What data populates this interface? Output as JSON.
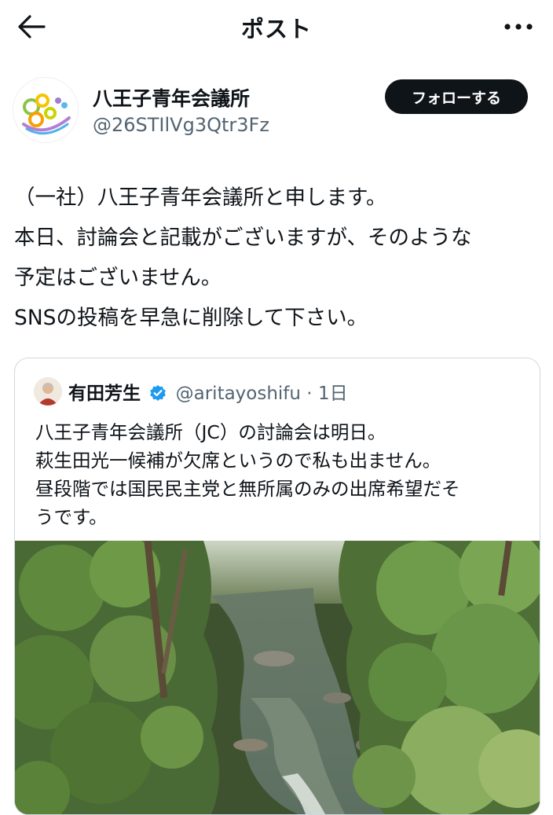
{
  "header": {
    "title": "ポスト"
  },
  "author": {
    "name": "八王子青年会議所",
    "handle": "@26STIlVg3Qtr3Fz",
    "follow_label": "フォローする"
  },
  "post": {
    "lines": [
      "（一社）八王子青年会議所と申します。",
      "本日、討論会と記載がございますが、そのような",
      "予定はございません。",
      "SNSの投稿を早急に削除して下さい。"
    ]
  },
  "quote": {
    "name": "有田芳生",
    "handle": "@aritayoshifu",
    "separator": " · ",
    "time": "1日",
    "lines": [
      "八王子青年会議所（JC）の討論会は明日。",
      "萩生田光一候補が欠席というので私も出ません。",
      "昼段階では国民民主党と無所属のみの出席希望だそ",
      "うです。"
    ],
    "verified_color": "#1d9bf0"
  },
  "icons": {
    "back": "arrow-left-icon",
    "more": "more-horizontal-icon",
    "verified": "verified-badge-icon"
  }
}
